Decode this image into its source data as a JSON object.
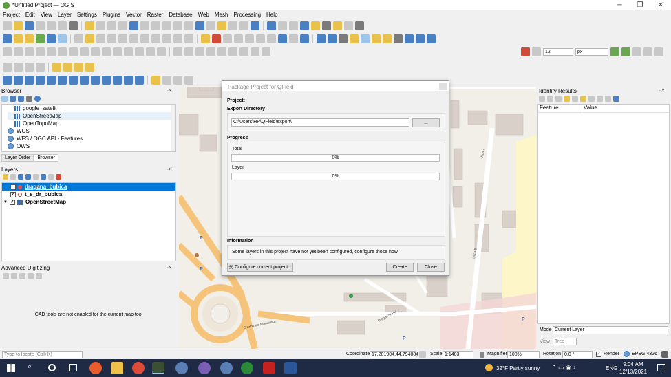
{
  "window": {
    "title": "*Untitled Project — QGIS",
    "minimize": "─",
    "maximize": "❐",
    "close": "✕"
  },
  "menu": [
    "Project",
    "Edit",
    "View",
    "Layer",
    "Settings",
    "Plugins",
    "Vector",
    "Raster",
    "Database",
    "Web",
    "Mesh",
    "Processing",
    "Help"
  ],
  "toolbar": {
    "size_value": "12",
    "size_unit": "px"
  },
  "browser": {
    "title": "Browser",
    "items": [
      {
        "label": "google_satelit",
        "icon": "xyz-tiles-icon"
      },
      {
        "label": "OpenStreetMap",
        "icon": "xyz-tiles-icon"
      },
      {
        "label": "OpenTopoMap",
        "icon": "xyz-tiles-icon"
      },
      {
        "label": "WCS",
        "icon": "wcs-icon"
      },
      {
        "label": "WFS / OGC API - Features",
        "icon": "wfs-icon"
      },
      {
        "label": "OWS",
        "icon": "ows-icon"
      }
    ],
    "tabs": [
      "Layer Order",
      "Browser"
    ]
  },
  "layers": {
    "title": "Layers",
    "items": [
      {
        "label": "dragana_bubica",
        "checked": true,
        "selected": true
      },
      {
        "label": "t_s_dr_bubica",
        "checked": true,
        "selected": false
      },
      {
        "label": "OpenStreetMap",
        "checked": true,
        "selected": false
      }
    ]
  },
  "advanced_digitizing": {
    "title": "Advanced Digitizing",
    "message": "CAD tools are not enabled for the current map tool"
  },
  "dialog": {
    "title": "Package Project for QField",
    "project_label": "Project:",
    "export_label": "Export Directory",
    "export_path": "C:\\Users\\HP\\QField\\export\\",
    "browse_label": "...",
    "progress_label": "Progress",
    "total_label": "Total",
    "total_value": "0%",
    "total_fraction": 0,
    "layer_label": "Layer",
    "layer_value": "0%",
    "layer_fraction": 0,
    "info_label": "Information",
    "info_text": "Some layers in this project have not yet been configured, configure those now.",
    "configure_label": "Configure current project...",
    "create_label": "Create",
    "close_label": "Close"
  },
  "identify": {
    "title": "Identify Results",
    "col_feature": "Feature",
    "col_value": "Value",
    "mode_label": "Mode",
    "mode_value": "Current Layer",
    "view_label": "View",
    "view_value": "Tree"
  },
  "status": {
    "locate_placeholder": "Type to locate (Ctrl+K)",
    "coordinate_label": "Coordinate",
    "coordinate_value": "17.201904,44.794084",
    "scale_label": "Scale",
    "scale_value": "1:1403",
    "magnifier_label": "Magnifier",
    "magnifier_value": "100%",
    "rotation_label": "Rotation",
    "rotation_value": "0.0 °",
    "render_label": "Render",
    "crs": "EPSG:4326"
  },
  "taskbar": {
    "weather": "32°F  Partly sunny",
    "lang": "ENG",
    "time": "9:04 AM",
    "date": "12/13/2021"
  },
  "map_labels": {
    "street1": "Ulica 4",
    "street2": "Svetozara Markovića",
    "street3": "Draganov Put",
    "street4": "Ulica 5"
  }
}
